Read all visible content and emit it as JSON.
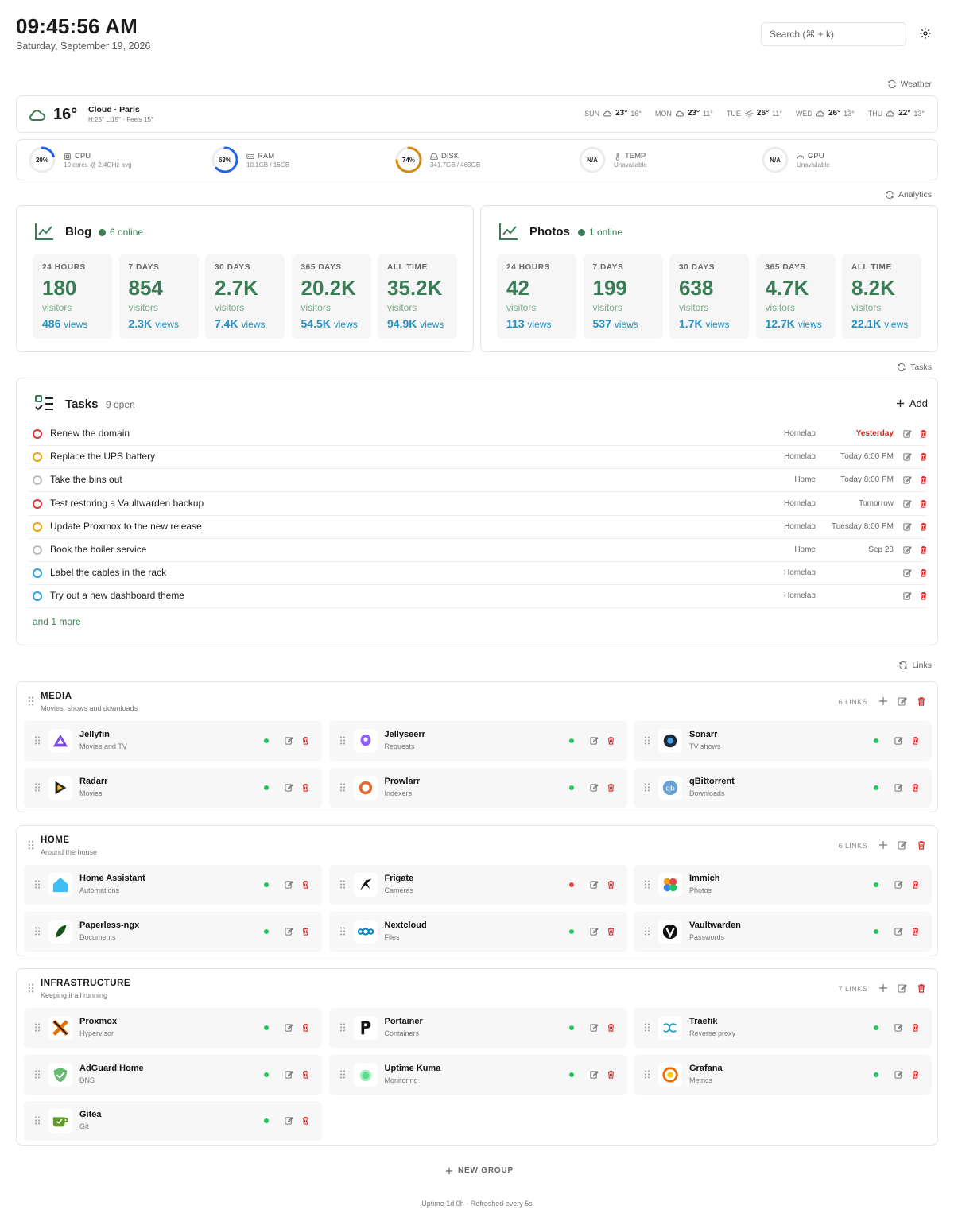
{
  "header": {
    "time": "09:45:56 AM",
    "date": "Saturday, September 19, 2026",
    "search_placeholder": "Search (⌘ + k)"
  },
  "weather": {
    "section_label": "Weather",
    "temp": "16°",
    "condition": "Cloud · Paris",
    "details": "H:25° L:15° · Feels 15°",
    "forecast": [
      {
        "day": "SUN",
        "icon": "cloud-icon",
        "hi": "23°",
        "lo": "16°"
      },
      {
        "day": "MON",
        "icon": "cloud-icon",
        "hi": "23°",
        "lo": "11°"
      },
      {
        "day": "TUE",
        "icon": "sun-icon",
        "hi": "26°",
        "lo": "11°"
      },
      {
        "day": "WED",
        "icon": "cloud-icon",
        "hi": "26°",
        "lo": "13°"
      },
      {
        "day": "THU",
        "icon": "cloud-icon",
        "hi": "22°",
        "lo": "13°"
      }
    ]
  },
  "system": [
    {
      "label": "CPU",
      "value": "20%",
      "percent": 20,
      "sub": "10 cores @ 2.4GHz avg",
      "color": "#2563eb",
      "icon": "cpu-icon"
    },
    {
      "label": "RAM",
      "value": "63%",
      "percent": 63,
      "sub": "10.1GB / 16GB",
      "color": "#2563eb",
      "icon": "memory-icon"
    },
    {
      "label": "DISK",
      "value": "74%",
      "percent": 74,
      "sub": "341.7GB / 460GB",
      "color": "#d48a10",
      "icon": "disk-icon"
    },
    {
      "label": "TEMP",
      "value": "N/A",
      "percent": 0,
      "sub": "Unavailable",
      "color": "#cccccc",
      "icon": "thermometer-icon"
    },
    {
      "label": "GPU",
      "value": "N/A",
      "percent": 0,
      "sub": "Unavailable",
      "color": "#cccccc",
      "icon": "gauge-icon"
    }
  ],
  "analytics": {
    "section_label": "Analytics",
    "sites": [
      {
        "name": "Blog",
        "online": "6 online",
        "stats": [
          {
            "period": "24 HOURS",
            "visitors": "180",
            "views": "486"
          },
          {
            "period": "7 DAYS",
            "visitors": "854",
            "views": "2.3K"
          },
          {
            "period": "30 DAYS",
            "visitors": "2.7K",
            "views": "7.4K"
          },
          {
            "period": "365 DAYS",
            "visitors": "20.2K",
            "views": "54.5K"
          },
          {
            "period": "ALL TIME",
            "visitors": "35.2K",
            "views": "94.9K"
          }
        ]
      },
      {
        "name": "Photos",
        "online": "1 online",
        "stats": [
          {
            "period": "24 HOURS",
            "visitors": "42",
            "views": "113"
          },
          {
            "period": "7 DAYS",
            "visitors": "199",
            "views": "537"
          },
          {
            "period": "30 DAYS",
            "visitors": "638",
            "views": "1.7K"
          },
          {
            "period": "365 DAYS",
            "visitors": "4.7K",
            "views": "12.7K"
          },
          {
            "period": "ALL TIME",
            "visitors": "8.2K",
            "views": "22.1K"
          }
        ]
      }
    ],
    "visitors_label": "visitors",
    "views_label": "views"
  },
  "tasks": {
    "section_label": "Tasks",
    "title": "Tasks",
    "count": "9 open",
    "add_label": "Add",
    "items": [
      {
        "title": "Renew the domain",
        "tag": "Homelab",
        "due": "Yesterday",
        "priority_color": "#e03131",
        "overdue": true
      },
      {
        "title": "Replace the UPS battery",
        "tag": "Homelab",
        "due": "Today 6:00 PM",
        "priority_color": "#f0a30a",
        "overdue": false
      },
      {
        "title": "Take the bins out",
        "tag": "Home",
        "due": "Today 8:00 PM",
        "priority_color": "#bbbbbb",
        "overdue": false
      },
      {
        "title": "Test restoring a Vaultwarden backup",
        "tag": "Homelab",
        "due": "Tomorrow",
        "priority_color": "#e03131",
        "overdue": false
      },
      {
        "title": "Update Proxmox to the new release",
        "tag": "Homelab",
        "due": "Tuesday 8:00 PM",
        "priority_color": "#f0a30a",
        "overdue": false
      },
      {
        "title": "Book the boiler service",
        "tag": "Home",
        "due": "Sep 28",
        "priority_color": "#bbbbbb",
        "overdue": false
      },
      {
        "title": "Label the cables in the rack",
        "tag": "Homelab",
        "due": "",
        "priority_color": "#2b9fd6",
        "overdue": false
      },
      {
        "title": "Try out a new dashboard theme",
        "tag": "Homelab",
        "due": "",
        "priority_color": "#2b9fd6",
        "overdue": false
      }
    ],
    "more": "and 1 more"
  },
  "links": {
    "section_label": "Links",
    "groups": [
      {
        "title": "MEDIA",
        "desc": "Movies, shows and downloads",
        "count": "6 LINKS",
        "items": [
          {
            "name": "Jellyfin",
            "desc": "Movies and TV",
            "up": true,
            "icon": "jellyfin-icon"
          },
          {
            "name": "Jellyseerr",
            "desc": "Requests",
            "up": true,
            "icon": "jellyseerr-icon"
          },
          {
            "name": "Sonarr",
            "desc": "TV shows",
            "up": true,
            "icon": "sonarr-icon"
          },
          {
            "name": "Radarr",
            "desc": "Movies",
            "up": true,
            "icon": "radarr-icon"
          },
          {
            "name": "Prowlarr",
            "desc": "Indexers",
            "up": true,
            "icon": "prowlarr-icon"
          },
          {
            "name": "qBittorrent",
            "desc": "Downloads",
            "up": true,
            "icon": "qbittorrent-icon"
          }
        ]
      },
      {
        "title": "HOME",
        "desc": "Around the house",
        "count": "6 LINKS",
        "items": [
          {
            "name": "Home Assistant",
            "desc": "Automations",
            "up": true,
            "icon": "home-assistant-icon"
          },
          {
            "name": "Frigate",
            "desc": "Cameras",
            "up": false,
            "icon": "frigate-icon"
          },
          {
            "name": "Immich",
            "desc": "Photos",
            "up": true,
            "icon": "immich-icon"
          },
          {
            "name": "Paperless-ngx",
            "desc": "Documents",
            "up": true,
            "icon": "paperless-icon"
          },
          {
            "name": "Nextcloud",
            "desc": "Files",
            "up": true,
            "icon": "nextcloud-icon"
          },
          {
            "name": "Vaultwarden",
            "desc": "Passwords",
            "up": true,
            "icon": "vaultwarden-icon"
          }
        ]
      },
      {
        "title": "INFRASTRUCTURE",
        "desc": "Keeping it all running",
        "count": "7 LINKS",
        "items": [
          {
            "name": "Proxmox",
            "desc": "Hypervisor",
            "up": true,
            "icon": "proxmox-icon"
          },
          {
            "name": "Portainer",
            "desc": "Containers",
            "up": true,
            "icon": "portainer-icon"
          },
          {
            "name": "Traefik",
            "desc": "Reverse proxy",
            "up": true,
            "icon": "traefik-icon"
          },
          {
            "name": "AdGuard Home",
            "desc": "DNS",
            "up": true,
            "icon": "adguard-icon"
          },
          {
            "name": "Uptime Kuma",
            "desc": "Monitoring",
            "up": true,
            "icon": "uptime-kuma-icon"
          },
          {
            "name": "Grafana",
            "desc": "Metrics",
            "up": true,
            "icon": "grafana-icon"
          },
          {
            "name": "Gitea",
            "desc": "Git",
            "up": true,
            "icon": "gitea-icon"
          }
        ]
      }
    ],
    "new_group_label": "NEW GROUP"
  },
  "footer": "Uptime 1d 0h · Refreshed every 5s",
  "colors": {
    "accent": "#3a7d55",
    "views": "#2390c0",
    "danger": "#dc2626",
    "up": "#22c55e",
    "down": "#ef4444"
  }
}
